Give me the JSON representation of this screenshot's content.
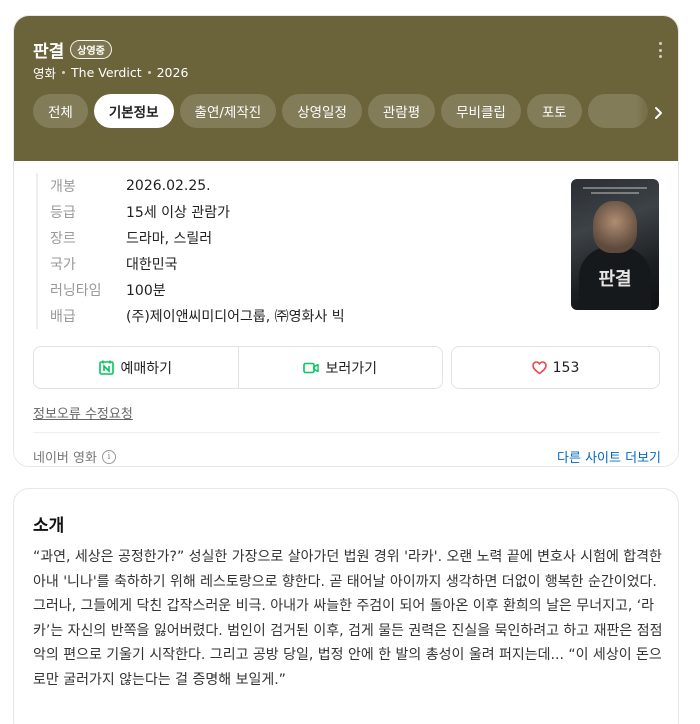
{
  "header": {
    "title": "판결",
    "status_badge": "상영중",
    "category": "영화",
    "english_title": "The Verdict",
    "year": "2026",
    "background_color": "#6b6339"
  },
  "tabs": [
    {
      "label": "전체",
      "active": false
    },
    {
      "label": "기본정보",
      "active": true
    },
    {
      "label": "출연/제작진",
      "active": false
    },
    {
      "label": "상영일정",
      "active": false
    },
    {
      "label": "관람평",
      "active": false
    },
    {
      "label": "무비클립",
      "active": false
    },
    {
      "label": "포토",
      "active": false
    }
  ],
  "info": {
    "rows": [
      {
        "label": "개봉",
        "value": "2026.02.25."
      },
      {
        "label": "등급",
        "value": "15세 이상 관람가"
      },
      {
        "label": "장르",
        "value": "드라마, 스릴러"
      },
      {
        "label": "국가",
        "value": "대한민국"
      },
      {
        "label": "러닝타임",
        "value": "100분"
      },
      {
        "label": "배급",
        "value": "(주)제이앤씨미디어그룹, ㈜영화사 빅"
      }
    ],
    "poster_title": "판결"
  },
  "actions": {
    "reserve_label": "예매하기",
    "watch_label": "보러가기",
    "like_count": "153",
    "accent_green": "#03c75a",
    "accent_red": "#f0474f"
  },
  "footer": {
    "report_link": "정보오류 수정요청",
    "source": "네이버 영화",
    "more_sites": "다른 사이트 더보기",
    "link_color": "#0068c3"
  },
  "intro": {
    "title": "소개",
    "text": "“과연, 세상은 공정한가?” 성실한 가장으로 살아가던 법원 경위 '라카'. 오랜 노력 끝에 변호사 시험에 합격한 아내 '니나'를 축하하기 위해 레스토랑으로 향한다. 곧 태어날 아이까지 생각하면 더없이 행복한 순간이었다. 그러나, 그들에게 닥친 갑작스러운 비극. 아내가 싸늘한 주검이 되어 돌아온 이후 환희의 날은 무너지고, ‘라카’는 자신의 반쪽을 잃어버렸다. 범인이 검거된 이후, 검게 물든 권력은 진실을 묵인하려고 하고 재판은 점점 악의 편으로 기울기 시작한다. 그리고 공방 당일, 법정 안에 한 발의 총성이 울려 퍼지는데... “이 세상이 돈으로만 굴러가지 않는다는 걸 증명해 보일게.”"
  }
}
